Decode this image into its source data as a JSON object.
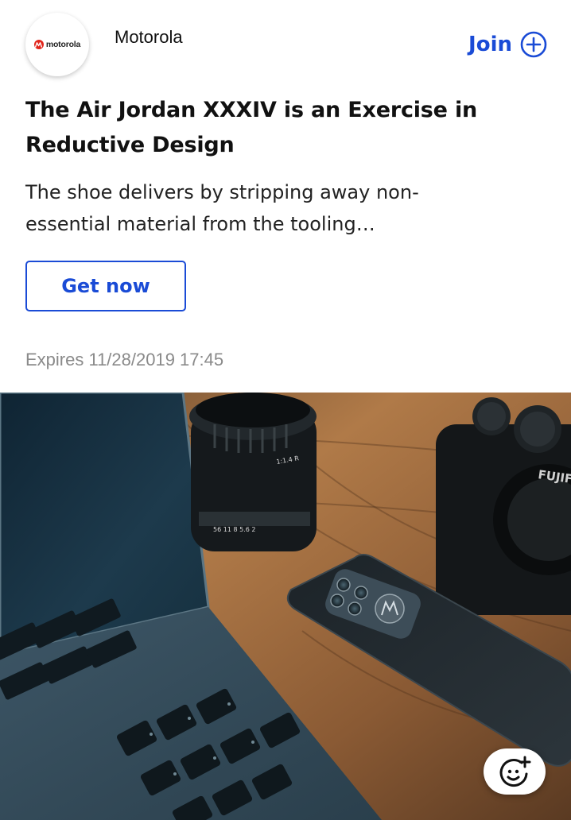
{
  "header": {
    "logo_text": "motorola",
    "brand_name": "Motorola",
    "join_label": "Join"
  },
  "article": {
    "title": "The Air Jordan XXXIV is an Exercise in Reductive Design",
    "description": "The shoe delivers by stripping away non-essential material from the tooling…"
  },
  "cta": {
    "label": "Get now"
  },
  "expiry": {
    "text": "Expires 11/28/2019 17:45"
  },
  "photo": {
    "camera_brand": "FUJIFI"
  },
  "icons": {
    "join": "plus-circle-icon",
    "reaction": "add-emoji-icon",
    "logo": "motorola-logo"
  },
  "colors": {
    "accent": "#1a4bd6",
    "muted_text": "#8a8a8a",
    "brand_red": "#e1251b"
  }
}
